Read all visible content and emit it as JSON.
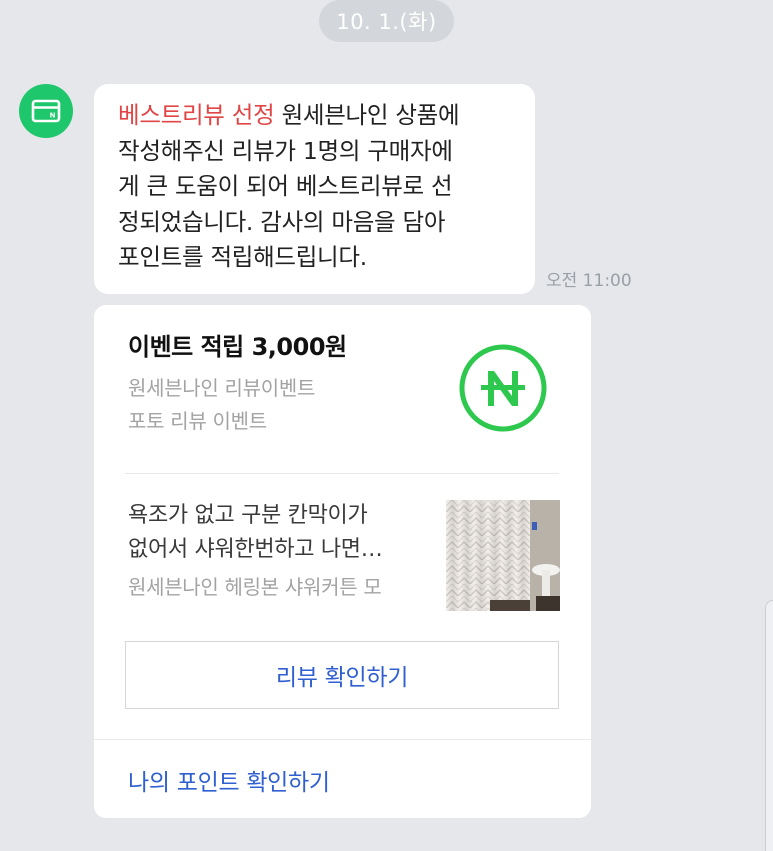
{
  "date_pill": "10. 1.(화)",
  "avatar": {
    "icon": "wallet-icon",
    "color": "#1ec76b"
  },
  "message": {
    "highlight": "베스트리뷰 선정",
    "line1_rest": "원세븐나인 상품에",
    "line2": "작성해주신 리뷰가 1명의 구매자에",
    "line3": "게 큰 도움이 되어 베스트리뷰로 선",
    "line4": "정되었습니다. 감사의 마음을 담아",
    "line5": "포인트를 적립해드립니다.",
    "highlight_color": "#e14545"
  },
  "timestamp": "오전 11:00",
  "card": {
    "title": "이벤트 적립 3,000원",
    "subtitle1": "원세븐나인 리뷰이벤트",
    "subtitle2": "포토 리뷰 이벤트",
    "logo_icon": "naver-pay-n-icon",
    "logo_color": "#2dc84d",
    "review": {
      "line1": "욕조가 없고 구분 칸막이가",
      "line2": "없어서 샤워한번하고 나면…",
      "product": "원세븐나인 헤링본 샤워커튼 모",
      "thumbnail": "shower-curtain-photo"
    },
    "review_button": "리뷰 확인하기",
    "points_link": "나의 포인트 확인하기",
    "link_color": "#2f5fd0"
  }
}
